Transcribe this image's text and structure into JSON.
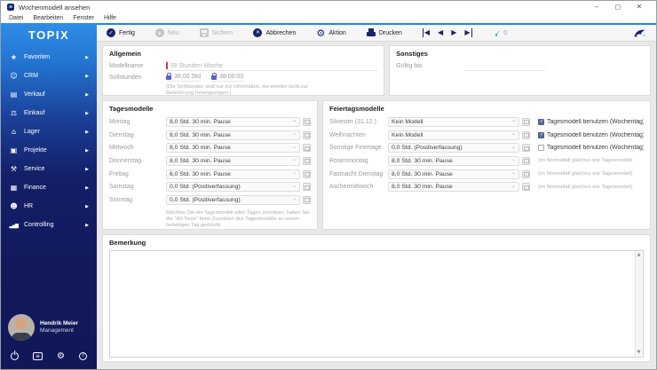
{
  "titlebar": {
    "title": "Wochenmodell ansehen",
    "minimize": "–",
    "maximize": "◻",
    "close": "✕"
  },
  "menubar": {
    "items": [
      {
        "label": "Datei"
      },
      {
        "label": "Bearbeiten"
      },
      {
        "label": "Fenster"
      },
      {
        "label": "Hilfe"
      }
    ]
  },
  "sidebar": {
    "logo": "TOPIX",
    "items": [
      {
        "label": "Favoriten",
        "icon": "star-icon"
      },
      {
        "label": "CRM",
        "icon": "crm-icon"
      },
      {
        "label": "Verkauf",
        "icon": "sales-icon"
      },
      {
        "label": "Einkauf",
        "icon": "cart-icon"
      },
      {
        "label": "Lager",
        "icon": "warehouse-icon"
      },
      {
        "label": "Projekte",
        "icon": "projects-icon"
      },
      {
        "label": "Service",
        "icon": "wrench-icon"
      },
      {
        "label": "Finance",
        "icon": "finance-icon"
      },
      {
        "label": "HR",
        "icon": "people-icon"
      },
      {
        "label": "Controlling",
        "icon": "chart-icon"
      }
    ],
    "user": {
      "name": "Hendrik Meier",
      "role": "Management"
    }
  },
  "toolbar": {
    "buttons": [
      {
        "label": "Fertig",
        "icon": "check-circle-icon",
        "state": "enabled"
      },
      {
        "label": "Neu",
        "icon": "plus-circle-icon",
        "state": "disabled"
      },
      {
        "label": "Sichern",
        "icon": "save-icon",
        "state": "disabled"
      },
      {
        "label": "Abbrechen",
        "icon": "cancel-circle-icon",
        "state": "enabled"
      },
      {
        "label": "Aktion",
        "icon": "gear-icon",
        "state": "enabled"
      },
      {
        "label": "Drucken",
        "icon": "printer-icon",
        "state": "enabled"
      }
    ],
    "record_count": "0"
  },
  "allgemein": {
    "title": "Allgemein",
    "modellname_label": "Modellname",
    "modellname_value": "38 Stunden Woche",
    "sollstunden_label": "Sollstunden",
    "sollstunden_dezimal": "38,00 Std",
    "sollstunden_zeit": "38:00:00",
    "note": "(Die Sollstunden sind nur zur Information, sie werden nicht zur Berechnung herangezogen.)"
  },
  "sonstiges": {
    "title": "Sonstiges",
    "gueltig_bis_label": "Gültig bis",
    "gueltig_bis_value": ""
  },
  "tagesmodelle": {
    "title": "Tagesmodelle",
    "rows": [
      {
        "label": "Montag",
        "value": "8,0 Std. 30 min. Pause"
      },
      {
        "label": "Dienstag",
        "value": "8,0 Std. 30 min. Pause"
      },
      {
        "label": "Mittwoch",
        "value": "8,0 Std. 30 min. Pause"
      },
      {
        "label": "Donnerstag",
        "value": "8,0 Std. 30 min. Pause"
      },
      {
        "label": "Freitag",
        "value": "6,0 Std. 30 min. Pause"
      },
      {
        "label": "Samstag",
        "value": "0,0 Std. (Positiverfassung)"
      },
      {
        "label": "Sonntag",
        "value": "0,0 Std. (Positiverfassung)"
      }
    ],
    "note": "Möchten Sie ein Tagesmodell allen Tagen zuordnen, halten Sie die \"Alt-Taste\" beim Zuordnen des Tagesmodells an einem beliebigen Tag gedrückt."
  },
  "feiertagsmodelle": {
    "title": "Feiertagsmodelle",
    "rows": [
      {
        "label": "Silvester (31.12.)",
        "value": "Kein Modell",
        "extra": "checkbox",
        "checked": true,
        "extra_label": "Tagesmodell benutzen (Wochentag)"
      },
      {
        "label": "Weihnachten",
        "value": "Kein Modell",
        "extra": "checkbox",
        "checked": true,
        "extra_label": "Tagesmodell benutzen (Wochentag)"
      },
      {
        "label": "Sonstige Feiertage",
        "value": "0,0 Std. (Positiverfassung)",
        "extra": "checkbox",
        "checked": false,
        "extra_label": "Tagesmodell benutzen (Wochentag)"
      },
      {
        "label": "Rosenmontag",
        "value": "8,0 Std. 30 min. Pause",
        "extra": "note",
        "extra_label": "(im Normalfall gleiches wie Tagesmodell)"
      },
      {
        "label": "Fastnacht Dienstag",
        "value": "8,0 Std. 30 min. Pause",
        "extra": "note",
        "extra_label": "(im Normalfall gleiches wie Tagesmodell)"
      },
      {
        "label": "Aschermittwoch",
        "value": "8,0 Std. 30 min. Pause",
        "extra": "note",
        "extra_label": "(im Normalfall gleiches wie Tagesmodell)"
      }
    ]
  },
  "bemerkung": {
    "title": "Bemerkung"
  },
  "colors": {
    "accent_blue": "#1e88e5",
    "navy": "#1a2464",
    "sidebar_dark": "#121a5c"
  }
}
